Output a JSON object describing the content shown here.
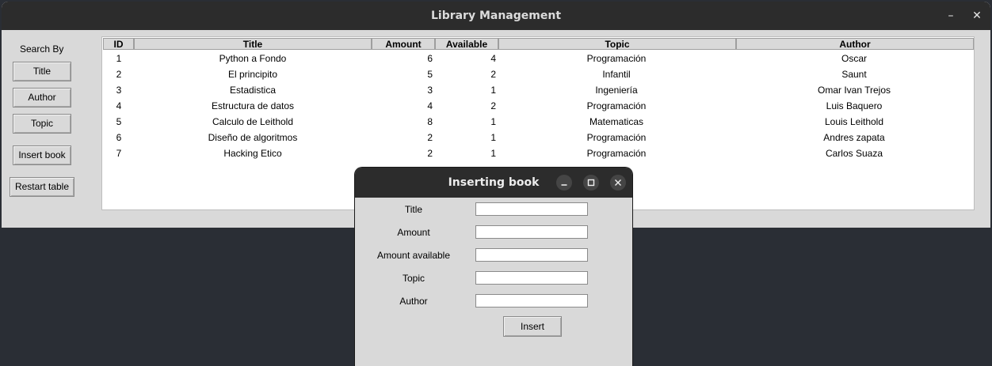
{
  "main_window": {
    "title": "Library Management",
    "minimize_glyph": "–",
    "close_glyph": "✕"
  },
  "sidebar": {
    "search_label": "Search By",
    "buttons": {
      "title": "Title",
      "author": "Author",
      "topic": "Topic",
      "insert": "Insert book",
      "restart": "Restart table"
    }
  },
  "table": {
    "headers": [
      "ID",
      "Title",
      "Amount",
      "Available",
      "Topic",
      "Author"
    ],
    "rows": [
      [
        "1",
        "Python a Fondo",
        "6",
        "4",
        "Programación",
        "Oscar"
      ],
      [
        "2",
        "El principito",
        "5",
        "2",
        "Infantil",
        "Saunt"
      ],
      [
        "3",
        "Estadistica",
        "3",
        "1",
        "Ingeniería",
        "Omar Ivan Trejos"
      ],
      [
        "4",
        "Estructura de datos",
        "4",
        "2",
        "Programación",
        "Luis Baquero"
      ],
      [
        "5",
        "Calculo de Leithold",
        "8",
        "1",
        "Matematicas",
        "Louis Leithold"
      ],
      [
        "6",
        "Diseño de algoritmos",
        "2",
        "1",
        "Programación",
        "Andres zapata"
      ],
      [
        "7",
        "Hacking Etico",
        "2",
        "1",
        "Programación",
        "Carlos Suaza"
      ]
    ]
  },
  "dialog": {
    "title": "Inserting book",
    "labels": {
      "title": "Title",
      "amount": "Amount",
      "available": "Amount available",
      "topic": "Topic",
      "author": "Author"
    },
    "values": {
      "title": "",
      "amount": "",
      "available": "",
      "topic": "",
      "author": ""
    },
    "insert_label": "Insert"
  },
  "icons": {
    "minimize": "minimize-icon",
    "maximize": "maximize-icon",
    "close": "close-icon"
  }
}
